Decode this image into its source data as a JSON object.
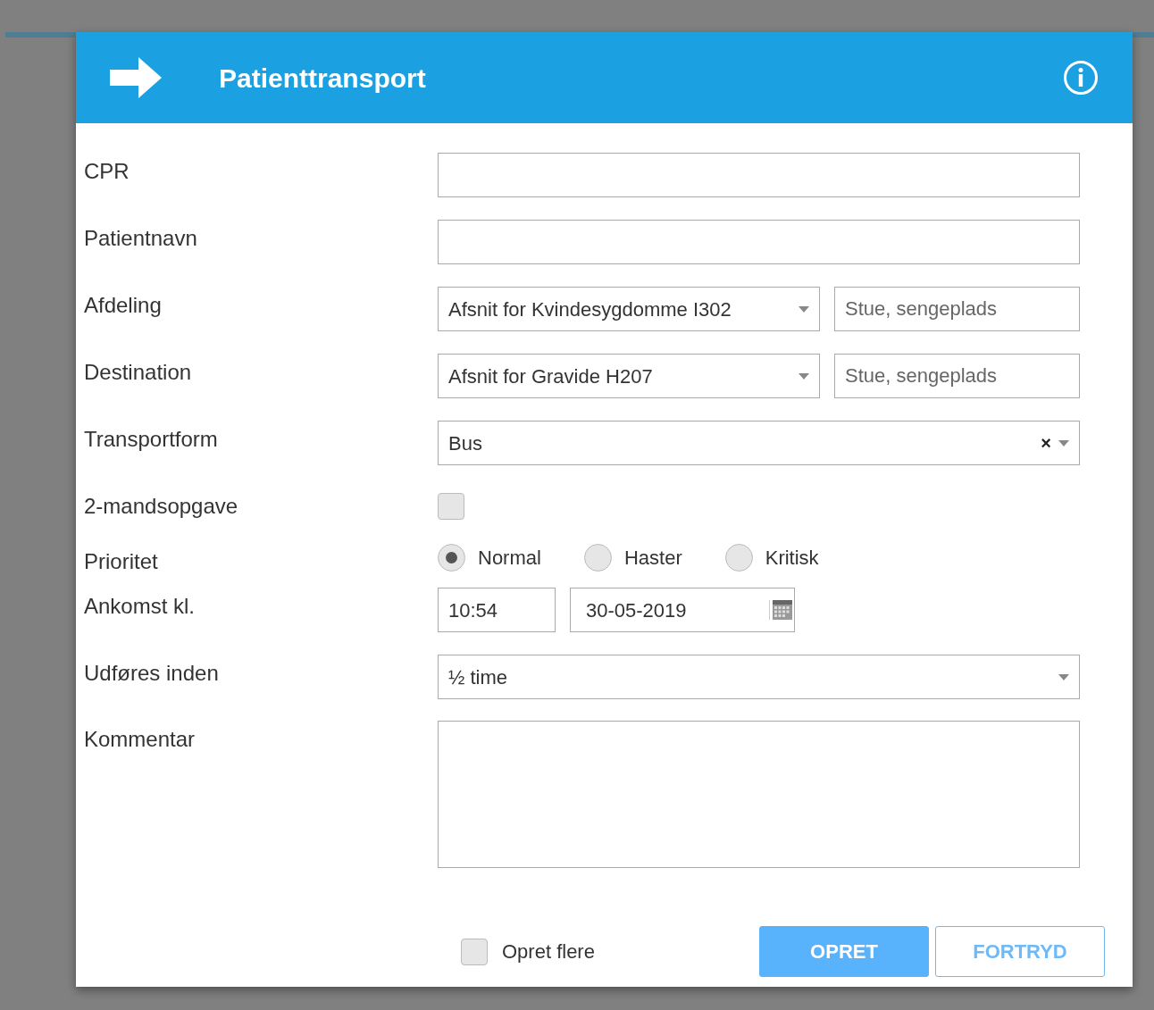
{
  "dialog": {
    "title": "Patienttransport"
  },
  "fields": [
    {
      "kind": "text",
      "label": "CPR"
    },
    {
      "kind": "text",
      "label": "Patientnavn"
    },
    {
      "kind": "select_with_text",
      "label": "Afdeling",
      "value": "Afsnit for Kvindesygdomme I302",
      "placeholder": "Stue, sengeplads"
    },
    {
      "kind": "select_with_text",
      "label": "Destination",
      "value": "Afsnit for Gravide H207",
      "placeholder": "Stue, sengeplads"
    },
    {
      "kind": "select_clearable",
      "label": "Transportform",
      "value": "Bus",
      "clear": "×"
    },
    {
      "kind": "checkbox",
      "label": "2-mandsopgave",
      "checked": false
    },
    {
      "kind": "radio",
      "label": "Prioritet",
      "options": [
        {
          "label": "Normal",
          "selected": true
        },
        {
          "label": "Haster",
          "selected": false
        },
        {
          "label": "Kritisk",
          "selected": false
        }
      ]
    },
    {
      "kind": "datetime",
      "label": "Ankomst kl.",
      "time": "10:54",
      "date": "30-05-2019"
    },
    {
      "kind": "select",
      "label": "Udføres inden",
      "value": "½ time"
    },
    {
      "kind": "textarea",
      "label": "Kommentar"
    }
  ],
  "footer": {
    "checkbox": {
      "label": "Opret flere",
      "checked": false
    },
    "buttons": [
      {
        "label": "OPRET",
        "kind": "primary"
      },
      {
        "label": "FORTRYD",
        "kind": "secondary"
      }
    ]
  }
}
